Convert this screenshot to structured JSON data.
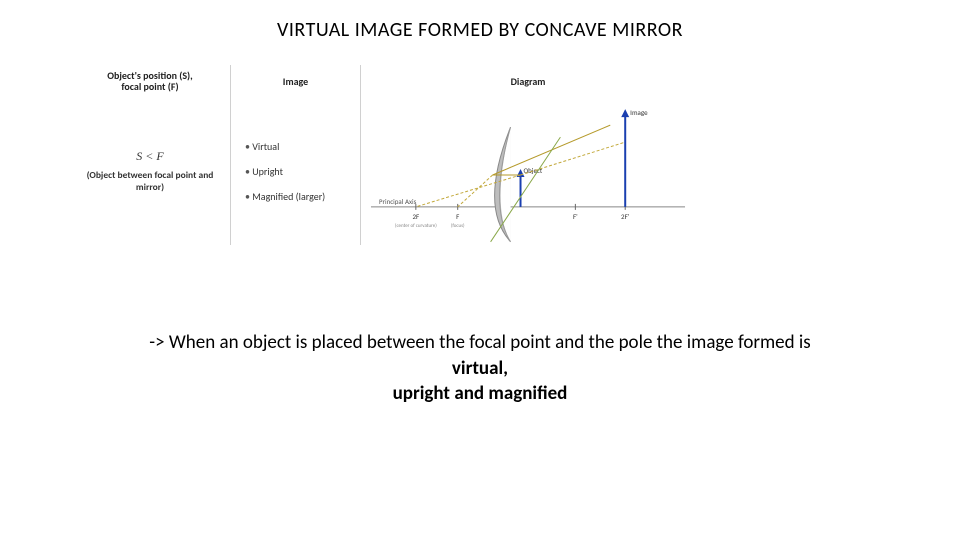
{
  "title": "VIRTUAL IMAGE FORMED BY CONCAVE MIRROR",
  "table": {
    "headers": {
      "col1a": "Object's position (S),",
      "col1b": "focal point (F)",
      "col2": "Image",
      "col3": "Diagram"
    },
    "row": {
      "condition_math": "S < F",
      "condition_text": "(Object between focal point and mirror)",
      "bullets": {
        "b1": "Virtual",
        "b2": "Upright",
        "b3": "Magnified (larger)"
      }
    }
  },
  "diagram": {
    "labels": {
      "image": "Image",
      "object": "Object",
      "principal_axis": "Principal Axis",
      "twoF": "2F",
      "twoF_sub": "(center of curvature)",
      "F": "F",
      "F_sub": "(focus)",
      "Fp": "F'",
      "twoFp": "2F'"
    }
  },
  "explanation": {
    "line1": "-> When an object is placed between the focal point and the pole the image formed is",
    "line2": "virtual,",
    "line3": "upright and magnified"
  }
}
